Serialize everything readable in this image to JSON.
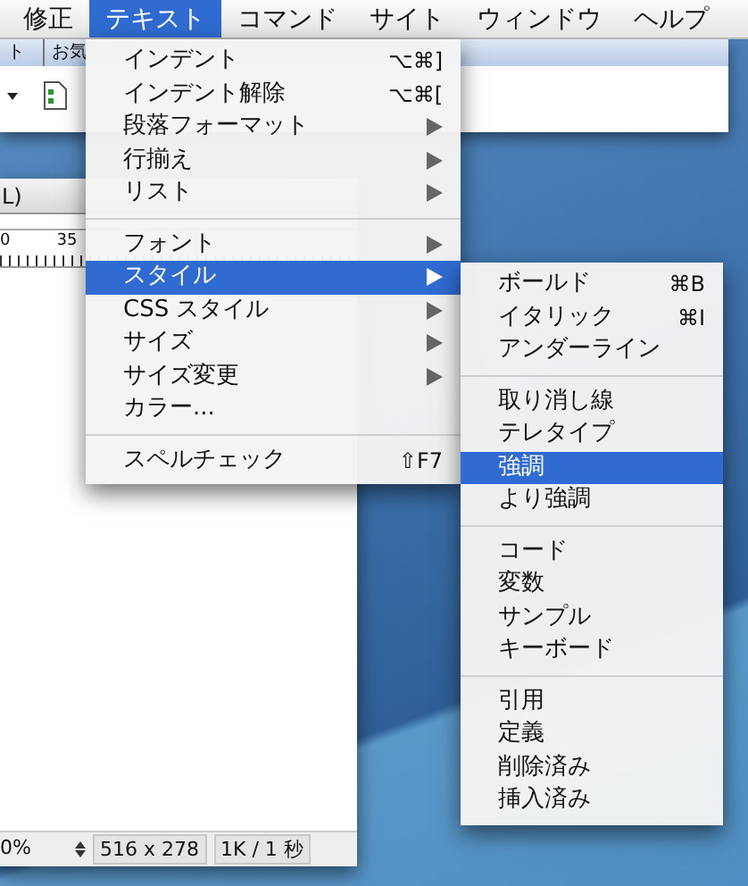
{
  "menubar": {
    "items": [
      {
        "label": "修正",
        "selected": false
      },
      {
        "label": "テキスト",
        "selected": true
      },
      {
        "label": "コマンド",
        "selected": false
      },
      {
        "label": "サイト",
        "selected": false
      },
      {
        "label": "ウィンドウ",
        "selected": false
      },
      {
        "label": "ヘルプ",
        "selected": false
      }
    ]
  },
  "toolbar_window": {
    "tabs": [
      "ト",
      "お気"
    ]
  },
  "document_window": {
    "title": "L)",
    "ruler_labels": [
      "0",
      "35"
    ],
    "status_bar": {
      "zoom": "0%",
      "window_size": "516 x 278",
      "download": "1K / 1 秒"
    }
  },
  "text_menu": {
    "items": [
      {
        "kind": "item",
        "label": "インデント",
        "shortcut": "⌥⌘]",
        "has_submenu": false,
        "selected": false
      },
      {
        "kind": "item",
        "label": "インデント解除",
        "shortcut": "⌥⌘[",
        "has_submenu": false,
        "selected": false
      },
      {
        "kind": "item",
        "label": "段落フォーマット",
        "has_submenu": true,
        "selected": false
      },
      {
        "kind": "item",
        "label": "行揃え",
        "has_submenu": true,
        "selected": false
      },
      {
        "kind": "item",
        "label": "リスト",
        "has_submenu": true,
        "selected": false
      },
      {
        "kind": "separator"
      },
      {
        "kind": "item",
        "label": "フォント",
        "has_submenu": true,
        "selected": false
      },
      {
        "kind": "item",
        "label": "スタイル",
        "has_submenu": true,
        "selected": true
      },
      {
        "kind": "item",
        "label": "CSS スタイル",
        "has_submenu": true,
        "selected": false
      },
      {
        "kind": "item",
        "label": "サイズ",
        "has_submenu": true,
        "selected": false
      },
      {
        "kind": "item",
        "label": "サイズ変更",
        "has_submenu": true,
        "selected": false
      },
      {
        "kind": "item",
        "label": "カラー...",
        "has_submenu": false,
        "selected": false
      },
      {
        "kind": "separator"
      },
      {
        "kind": "item",
        "label": "スペルチェック",
        "shortcut": "⇧F7",
        "has_submenu": false,
        "selected": false
      }
    ]
  },
  "style_submenu": {
    "items": [
      {
        "kind": "item",
        "label": "ボールド",
        "shortcut": "⌘B",
        "selected": false
      },
      {
        "kind": "item",
        "label": "イタリック",
        "shortcut": "⌘I",
        "selected": false
      },
      {
        "kind": "item",
        "label": "アンダーライン",
        "selected": false
      },
      {
        "kind": "separator"
      },
      {
        "kind": "item",
        "label": "取り消し線",
        "selected": false
      },
      {
        "kind": "item",
        "label": "テレタイプ",
        "selected": false
      },
      {
        "kind": "item",
        "label": "強調",
        "selected": true
      },
      {
        "kind": "item",
        "label": "より強調",
        "selected": false
      },
      {
        "kind": "separator"
      },
      {
        "kind": "item",
        "label": "コード",
        "selected": false
      },
      {
        "kind": "item",
        "label": "変数",
        "selected": false
      },
      {
        "kind": "item",
        "label": "サンプル",
        "selected": false
      },
      {
        "kind": "item",
        "label": "キーボード",
        "selected": false
      },
      {
        "kind": "separator"
      },
      {
        "kind": "item",
        "label": "引用",
        "selected": false
      },
      {
        "kind": "item",
        "label": "定義",
        "selected": false
      },
      {
        "kind": "item",
        "label": "削除済み",
        "selected": false
      },
      {
        "kind": "item",
        "label": "挿入済み",
        "selected": false
      }
    ]
  }
}
